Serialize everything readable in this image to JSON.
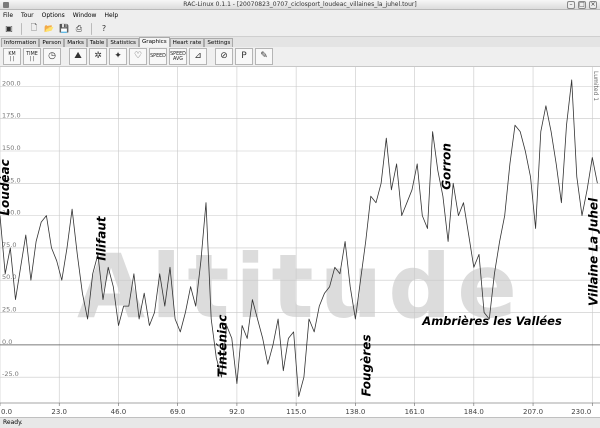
{
  "window": {
    "title": "RAC-Linux 0.1.1 - [20070823_0707_ciclosport_loudeac_villaines_la_juhel.tour]"
  },
  "menu": [
    "File",
    "Tour",
    "Options",
    "Window",
    "Help"
  ],
  "tabs": [
    "Information",
    "Person",
    "Marks",
    "Table",
    "Statistics",
    "Graphics",
    "Heart rate",
    "Settings"
  ],
  "active_tab": "Graphics",
  "graph_toolbar": {
    "km_line1": "KM",
    "km_line2": "| |",
    "time_line1": "TIME",
    "time_line2": "| |",
    "speed1": "SPEED",
    "speed2a": "SPEED",
    "speed2b": "AVG"
  },
  "watermark": "Altitude",
  "right_edge_label": "Lumited 1",
  "status": "Ready.",
  "chart_data": {
    "type": "line",
    "xlabel": "",
    "ylabel": "",
    "xlim": [
      0,
      233
    ],
    "ylim": [
      -45,
      215
    ],
    "x_ticks": [
      0,
      23,
      46,
      69,
      92,
      115,
      138,
      161,
      184,
      207,
      230
    ],
    "x_tick_labels": [
      "0.0",
      "23.0",
      "46.0",
      "69.0",
      "92.0",
      "115.0",
      "138.0",
      "161.0",
      "184.0",
      "207.0",
      "230.0"
    ],
    "y_ticks": [
      -25,
      0,
      25,
      50,
      75,
      100,
      125,
      150,
      175,
      200
    ],
    "y_tick_labels": [
      "-25.0",
      "0.0",
      "25.0",
      "50.0",
      "75.0",
      "100.0",
      "125.0",
      "150.0",
      "175.0",
      "200.0"
    ],
    "grid": true,
    "zero_line": true,
    "series": [
      {
        "name": "",
        "x": [
          0,
          2,
          4,
          6,
          8,
          10,
          12,
          14,
          16,
          18,
          20,
          22,
          24,
          26,
          28,
          30,
          32,
          34,
          36,
          38,
          40,
          42,
          44,
          46,
          48,
          50,
          52,
          54,
          56,
          58,
          60,
          62,
          64,
          66,
          68,
          70,
          72,
          74,
          76,
          78,
          80,
          82,
          84,
          86,
          88,
          90,
          92,
          94,
          96,
          98,
          100,
          102,
          104,
          106,
          108,
          110,
          112,
          114,
          116,
          118,
          120,
          122,
          124,
          126,
          128,
          130,
          132,
          134,
          136,
          138,
          140,
          142,
          144,
          146,
          148,
          150,
          152,
          154,
          156,
          158,
          160,
          162,
          164,
          166,
          168,
          170,
          172,
          174,
          176,
          178,
          180,
          182,
          184,
          186,
          188,
          190,
          192,
          194,
          196,
          198,
          200,
          202,
          204,
          206,
          208,
          210,
          212,
          214,
          216,
          218,
          220,
          222,
          224,
          226,
          228,
          230,
          232
        ],
        "y": [
          100,
          55,
          75,
          35,
          60,
          85,
          50,
          80,
          95,
          100,
          75,
          65,
          50,
          75,
          105,
          70,
          40,
          20,
          55,
          70,
          35,
          60,
          45,
          15,
          30,
          30,
          55,
          20,
          40,
          15,
          25,
          55,
          30,
          60,
          20,
          10,
          25,
          45,
          30,
          65,
          110,
          20,
          -10,
          -25,
          15,
          5,
          -30,
          15,
          5,
          35,
          20,
          5,
          -15,
          0,
          20,
          -20,
          5,
          10,
          -40,
          -25,
          20,
          10,
          30,
          40,
          45,
          60,
          55,
          80,
          45,
          20,
          50,
          80,
          115,
          110,
          125,
          160,
          120,
          140,
          100,
          110,
          120,
          140,
          100,
          90,
          165,
          135,
          115,
          80,
          125,
          100,
          110,
          85,
          60,
          70,
          25,
          20,
          55,
          80,
          100,
          140,
          170,
          165,
          150,
          130,
          90,
          165,
          185,
          165,
          140,
          110,
          170,
          205,
          130,
          100,
          120,
          145,
          125
        ]
      }
    ],
    "annotations": [
      {
        "text": "Loudéac",
        "x": 1.5,
        "y": 100
      },
      {
        "text": "Illifaut",
        "x": 39,
        "y": 65
      },
      {
        "text": "Tinténiac",
        "x": 86,
        "y": -25
      },
      {
        "text": "Fougères",
        "x": 142,
        "y": -40
      },
      {
        "text": "Gorron",
        "x": 173,
        "y": 120
      },
      {
        "text": "Ambrières les Vallées",
        "x": 164,
        "y": 20
      },
      {
        "text": "Villaine La Juhel",
        "x": 230,
        "y": 30
      }
    ]
  }
}
